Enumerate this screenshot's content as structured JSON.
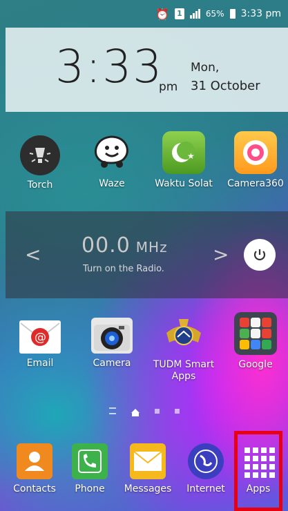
{
  "status_bar": {
    "battery": "65%",
    "time": "3:33 pm",
    "sim": "1"
  },
  "clock": {
    "time": "3:33",
    "ampm": "pm",
    "day": "Mon,",
    "date": "31 October"
  },
  "row1": [
    {
      "label": "Torch",
      "icon": "torch-icon"
    },
    {
      "label": "Waze",
      "icon": "waze-icon"
    },
    {
      "label": "Waktu Solat",
      "icon": "waktu-solat-icon"
    },
    {
      "label": "Camera360",
      "icon": "camera360-icon"
    }
  ],
  "radio": {
    "frequency": "00.0",
    "unit": "MHz",
    "hint": "Turn on the Radio."
  },
  "row2": [
    {
      "label": "Email",
      "icon": "email-icon"
    },
    {
      "label": "Camera",
      "icon": "camera-icon"
    },
    {
      "label": "TUDM Smart Apps",
      "icon": "tudm-icon"
    },
    {
      "label": "Google",
      "icon": "google-folder-icon"
    }
  ],
  "dock": [
    {
      "label": "Contacts",
      "icon": "contacts-icon"
    },
    {
      "label": "Phone",
      "icon": "phone-icon"
    },
    {
      "label": "Messages",
      "icon": "messages-icon"
    },
    {
      "label": "Internet",
      "icon": "internet-icon"
    },
    {
      "label": "Apps",
      "icon": "apps-grid-icon"
    }
  ],
  "colors": {
    "highlight": "#e80010",
    "email": "#e02a2a",
    "phone": "#3db24a",
    "contacts": "#f08a1e",
    "messages": "#f5b91e",
    "internet": "#3b3fbf"
  }
}
